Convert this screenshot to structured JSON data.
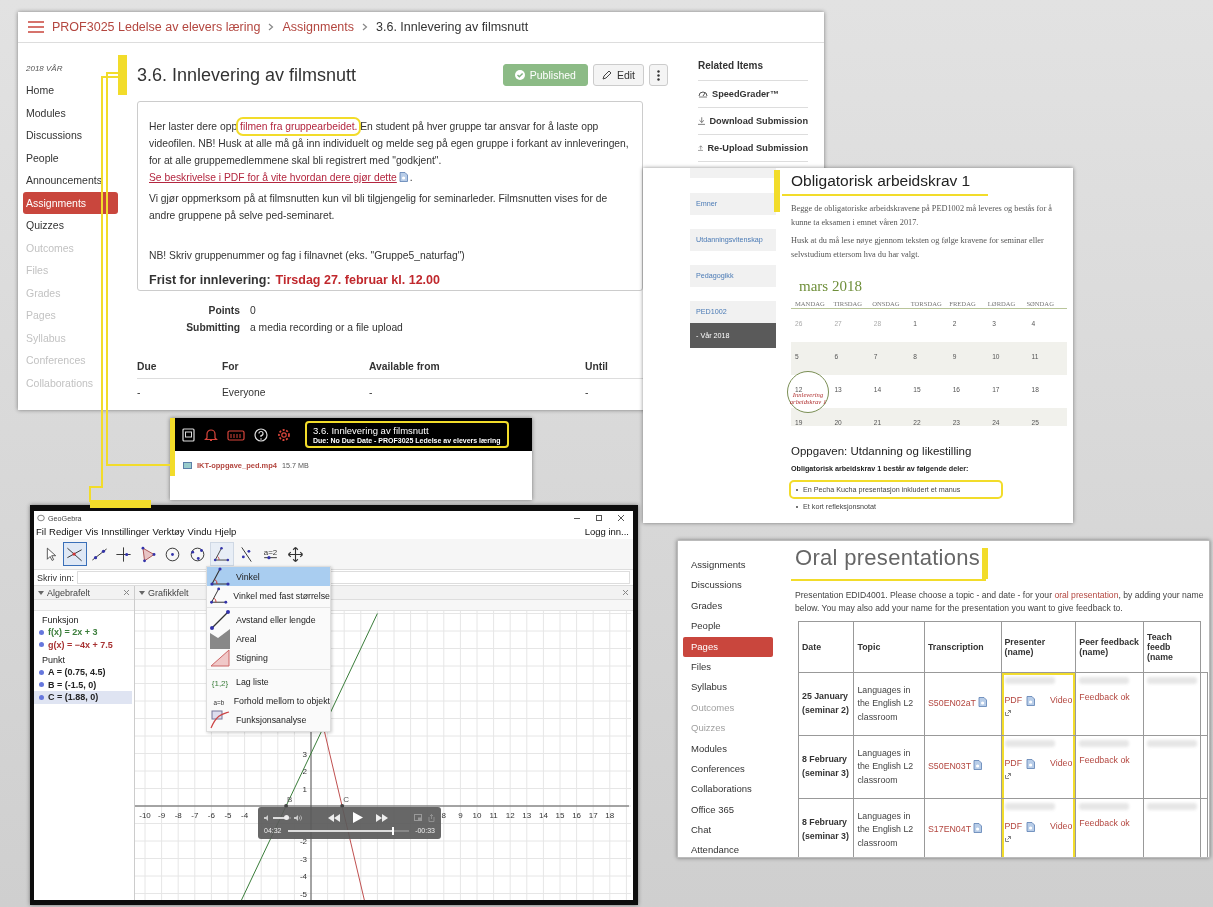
{
  "canvas_page": {
    "breadcrumb": [
      {
        "label": "PROF3025 Ledelse av elevers læring",
        "kind": "link"
      },
      {
        "label": "Assignments",
        "kind": "link"
      },
      {
        "label": "3.6. Innlevering av filmsnutt",
        "kind": "current"
      }
    ],
    "term": "2018 VÅR",
    "nav": [
      {
        "label": "Home",
        "selected": false,
        "disabled": false
      },
      {
        "label": "Modules",
        "selected": false,
        "disabled": false
      },
      {
        "label": "Discussions",
        "selected": false,
        "disabled": false
      },
      {
        "label": "People",
        "selected": false,
        "disabled": false
      },
      {
        "label": "Announcements",
        "selected": false,
        "disabled": false
      },
      {
        "label": "Assignments",
        "selected": true,
        "disabled": false
      },
      {
        "label": "Quizzes",
        "selected": false,
        "disabled": false
      },
      {
        "label": "Outcomes",
        "selected": false,
        "disabled": true
      },
      {
        "label": "Files",
        "selected": false,
        "disabled": true
      },
      {
        "label": "Grades",
        "selected": false,
        "disabled": true
      },
      {
        "label": "Pages",
        "selected": false,
        "disabled": true
      },
      {
        "label": "Syllabus",
        "selected": false,
        "disabled": true
      },
      {
        "label": "Conferences",
        "selected": false,
        "disabled": true
      },
      {
        "label": "Collaborations",
        "selected": false,
        "disabled": true
      }
    ],
    "title": "3.6. Innlevering av filmsnutt",
    "status_button": "Published",
    "edit_button": "Edit",
    "description": [
      [
        {
          "kind": "text",
          "text": "Her laster dere opp "
        },
        {
          "kind": "link",
          "text": "filmen fra gruppearbeidet.",
          "highlighted": true
        },
        {
          "kind": "text",
          "text": " En student på hver gruppe tar ansvar for å laste opp videofilen. NB! Husk at alle må gå inn individuelt og melde seg på egen gruppe i forkant av innleveringen, for at alle gruppemedlemmene skal bli registrert med \"godkjent\". "
        },
        {
          "kind": "link",
          "text": "Se beskrivelse i PDF for å vite hvordan dere gjør dette",
          "highlighted": false
        },
        {
          "kind": "file_icon"
        },
        {
          "kind": "text",
          "text": "."
        }
      ],
      [
        {
          "kind": "text",
          "text": "Vi gjør oppmerksom på at filmsnutten kun vil bli tilgjengelig for seminarleder. Filmsnutten vises for de andre gruppene på selve ped-seminaret."
        }
      ]
    ],
    "note": "NB! Skriv gruppenummer og fag i filnavnet (eks. \"Gruppe5_naturfag\")",
    "deadline": {
      "label": "Frist for innlevering:",
      "value": "Tirsdag 27. februar kl. 12.00"
    },
    "details": [
      {
        "label": "Points",
        "value": "0"
      },
      {
        "label": "Submitting",
        "value": "a media recording or a file upload"
      }
    ],
    "dates_table": {
      "columns": [
        "Due",
        "For",
        "Available from",
        "Until"
      ],
      "rows": [
        [
          "-",
          "Everyone",
          "-",
          "-"
        ]
      ]
    },
    "related": {
      "title": "Related Items",
      "items": [
        {
          "label": "SpeedGrader™",
          "kind": "speedgrader"
        },
        {
          "label": "Download Submission",
          "kind": "download"
        },
        {
          "label": "Re-Upload Submission",
          "kind": "upload"
        }
      ]
    }
  },
  "course_page": {
    "nav": [
      {
        "label": "Emner",
        "selected": false
      },
      {
        "label": "Utdanningsvitenskap",
        "selected": false
      },
      {
        "label": "Pedagogikk",
        "selected": false
      },
      {
        "label": "PED1002",
        "selected": false
      },
      {
        "label": "- Vår 2018",
        "selected": true
      }
    ],
    "title": "Obligatorisk arbeidskrav 1",
    "paragraphs": [
      "Begge de obligatoriske arbeidskravene på PED1002 må leveres og bestås for å kunne ta eksamen i emnet våren 2017.",
      "Husk at du må lese nøye gjennom teksten og følge kravene for seminar eller selvstudium ettersom hva du har valgt."
    ],
    "calendar": {
      "month": "mars 2018",
      "weekdays": [
        "MANDAG",
        "TIRSDAG",
        "ONSDAG",
        "TORSDAG",
        "FREDAG",
        "LØRDAG",
        "SØNDAG"
      ],
      "weeks": [
        [
          {
            "day": "26",
            "muted": true
          },
          {
            "day": "27",
            "muted": true
          },
          {
            "day": "28",
            "muted": true
          },
          {
            "day": "1",
            "muted": false
          },
          {
            "day": "2",
            "muted": false
          },
          {
            "day": "3",
            "muted": false
          },
          {
            "day": "4",
            "muted": false
          }
        ],
        [
          {
            "day": "5",
            "muted": false
          },
          {
            "day": "6",
            "muted": false
          },
          {
            "day": "7",
            "muted": false
          },
          {
            "day": "8",
            "muted": false
          },
          {
            "day": "9",
            "muted": false
          },
          {
            "day": "10",
            "muted": false
          },
          {
            "day": "11",
            "muted": false
          }
        ],
        [
          {
            "day": "12",
            "muted": false,
            "event": "Innlevering arbeidskrav 1"
          },
          {
            "day": "13",
            "muted": false
          },
          {
            "day": "14",
            "muted": false
          },
          {
            "day": "15",
            "muted": false
          },
          {
            "day": "16",
            "muted": false
          },
          {
            "day": "17",
            "muted": false
          },
          {
            "day": "18",
            "muted": false
          }
        ],
        [
          {
            "day": "19",
            "muted": false
          },
          {
            "day": "20",
            "muted": false
          },
          {
            "day": "21",
            "muted": false
          },
          {
            "day": "22",
            "muted": false
          },
          {
            "day": "23",
            "muted": false
          },
          {
            "day": "24",
            "muted": false
          },
          {
            "day": "25",
            "muted": false
          }
        ]
      ]
    },
    "subheading": "Oppgaven: Utdanning og likestilling",
    "list_intro": "Obligatorisk arbeidskrav 1 består av følgende deler:",
    "list": [
      {
        "text": "En Pecha Kucha presentasjon inkludert et manus",
        "highlighted": true
      },
      {
        "text": "Et kort refleksjonsnotat",
        "highlighted": false
      }
    ]
  },
  "media_bar": {
    "title": "3.6. Innlevering av filmsnutt",
    "subtitle": "Due: No Due Date - PROF3025 Ledelse av elevers læring",
    "highlighted": true,
    "file": {
      "name": "IKT-oppgave_ped.mp4",
      "size": "15.7 MB"
    }
  },
  "geogebra": {
    "app_title": "GeoGebra",
    "menu": [
      "Fil",
      "Rediger",
      "Vis",
      "Innstillinger",
      "Verktøy",
      "Vindu",
      "Hjelp"
    ],
    "login": "Logg inn...",
    "tools": [
      {
        "kind": "select",
        "selected": false,
        "expanded": false
      },
      {
        "kind": "intersect",
        "selected": true,
        "expanded": false
      },
      {
        "kind": "line",
        "selected": false,
        "expanded": false
      },
      {
        "kind": "perpendicular",
        "selected": false,
        "expanded": false
      },
      {
        "kind": "polygon",
        "selected": false,
        "expanded": false
      },
      {
        "kind": "circle",
        "selected": false,
        "expanded": false
      },
      {
        "kind": "circle3",
        "selected": false,
        "expanded": false
      },
      {
        "kind": "angle",
        "selected": false,
        "expanded": true
      },
      {
        "kind": "reflect",
        "selected": false,
        "expanded": false
      },
      {
        "kind": "slider",
        "selected": false,
        "expanded": false,
        "glyph": "a=2"
      },
      {
        "kind": "move_view",
        "selected": false,
        "expanded": false
      }
    ],
    "input_label": "Skriv inn:",
    "algebra": {
      "title": "Algebrafelt",
      "groups": [
        {
          "label": "Funksjon",
          "items": [
            {
              "text": "f(x) = 2x + 3",
              "color": "#3a7d3a",
              "selected": false
            },
            {
              "text": "g(x) = −4x + 7.5",
              "color": "#a83232",
              "selected": false
            }
          ]
        },
        {
          "label": "Punkt",
          "items": [
            {
              "text": "A = (0.75, 4.5)",
              "color": "#222222",
              "selected": false
            },
            {
              "text": "B = (-1.5, 0)",
              "color": "#222222",
              "selected": false
            },
            {
              "text": "C = (1.88, 0)",
              "color": "#222222",
              "selected": true
            }
          ]
        }
      ]
    },
    "graphics": {
      "title": "Grafikkfelt",
      "x_ticks": [
        "-10",
        "-9",
        "-8",
        "-7",
        "-6",
        "-5",
        "-4",
        "8",
        "9",
        "10",
        "11",
        "12",
        "13",
        "14",
        "15",
        "16",
        "17",
        "18"
      ],
      "y_ticks": [
        "3",
        "2",
        "1",
        "-2",
        "-3",
        "-4",
        "-5"
      ],
      "points": [
        "B",
        "C"
      ]
    },
    "tool_menu": [
      {
        "items": [
          {
            "label": "Vinkel",
            "kind": "angle",
            "selected": true
          },
          {
            "label": "Vinkel med fast størrelse",
            "kind": "angle_fixed",
            "selected": false
          }
        ]
      },
      {
        "items": [
          {
            "label": "Avstand eller lengde",
            "kind": "distance",
            "selected": false
          },
          {
            "label": "Areal",
            "kind": "area",
            "selected": false
          },
          {
            "label": "Stigning",
            "kind": "slope",
            "selected": false
          }
        ]
      },
      {
        "items": [
          {
            "label": "Lag liste",
            "kind": "list",
            "selected": false,
            "glyph": "{1,2}"
          },
          {
            "label": "Forhold mellom to objekt",
            "kind": "relation",
            "selected": false,
            "glyph": "a=b"
          },
          {
            "label": "Funksjonsanalyse",
            "kind": "inspector",
            "selected": false
          }
        ]
      }
    ],
    "player": {
      "elapsed": "04:32",
      "remaining": "-00:33",
      "level": 0.86,
      "volume": {
        "level": 0.7
      }
    }
  },
  "oral_page": {
    "nav": [
      {
        "label": "Assignments",
        "selected": false,
        "disabled": false
      },
      {
        "label": "Discussions",
        "selected": false,
        "disabled": false
      },
      {
        "label": "Grades",
        "selected": false,
        "disabled": false
      },
      {
        "label": "People",
        "selected": false,
        "disabled": false
      },
      {
        "label": "Pages",
        "selected": true,
        "disabled": false
      },
      {
        "label": "Files",
        "selected": false,
        "disabled": false
      },
      {
        "label": "Syllabus",
        "selected": false,
        "disabled": false
      },
      {
        "label": "Outcomes",
        "selected": false,
        "disabled": true
      },
      {
        "label": "Quizzes",
        "selected": false,
        "disabled": true
      },
      {
        "label": "Modules",
        "selected": false,
        "disabled": false
      },
      {
        "label": "Conferences",
        "selected": false,
        "disabled": false
      },
      {
        "label": "Collaborations",
        "selected": false,
        "disabled": false
      },
      {
        "label": "Office 365",
        "selected": false,
        "disabled": false
      },
      {
        "label": "Chat",
        "selected": false,
        "disabled": false
      },
      {
        "label": "Attendance",
        "selected": false,
        "disabled": false
      }
    ],
    "title": "Oral presentations",
    "intro": [
      {
        "kind": "text",
        "text": "Presentation EDID4001. Please choose a topic - and date - for your "
      },
      {
        "kind": "link",
        "text": "oral presentation"
      },
      {
        "kind": "text",
        "text": ", by adding your name below. You may also add your name for the presentation you want to give feedback to."
      }
    ],
    "table": {
      "columns": [
        {
          "label": "Date",
          "highlighted": false
        },
        {
          "label": "Topic",
          "highlighted": false
        },
        {
          "label": "Transcription",
          "highlighted": false
        },
        {
          "label": "Presenter (name)",
          "highlighted": true
        },
        {
          "label": "Peer feedback (name)",
          "highlighted": false
        },
        {
          "label": "Teach feedb (name",
          "highlighted": false
        }
      ],
      "rows": [
        {
          "date": "25 January (seminar 2)",
          "topic": "Languages in the English L2 classroom",
          "transcription": "S50EN02aT",
          "pdf": "PDF",
          "video": "Video",
          "feedback": "Feedback ok"
        },
        {
          "date": "8 February (seminar 3)",
          "topic": "Languages in the English L2 classroom",
          "transcription": "S50EN03T",
          "pdf": "PDF",
          "video": "Video",
          "feedback": "Feedback ok"
        },
        {
          "date": "8 February (seminar 3)",
          "topic": "Languages in the English L2 classroom",
          "transcription": "S17EN04T",
          "pdf": "PDF",
          "video": "Video",
          "feedback": "Feedback ok"
        }
      ]
    }
  }
}
